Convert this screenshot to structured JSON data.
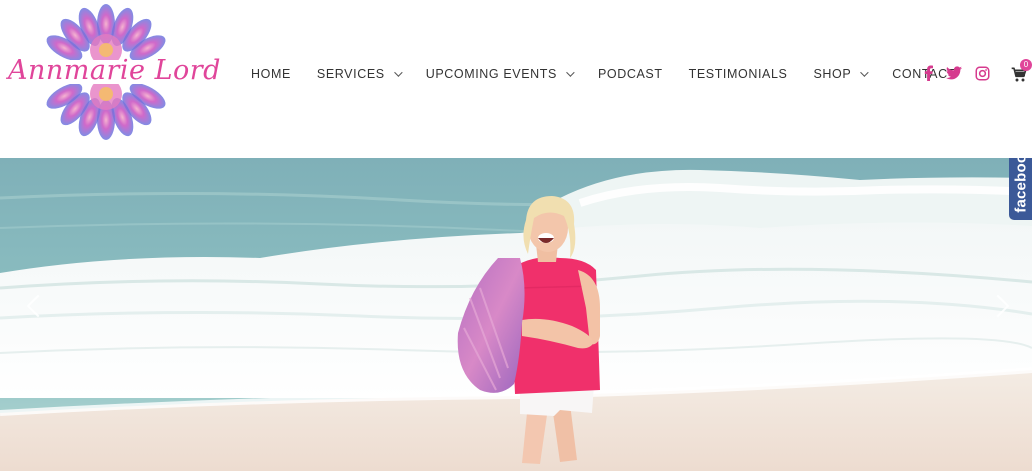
{
  "brand": {
    "logo_text": "Annmarie Lord",
    "colors": {
      "pink": "#e0459a",
      "purple": "#9b59d0",
      "blue": "#4a78d6"
    }
  },
  "nav": {
    "items": [
      {
        "label": "HOME",
        "has_dropdown": false
      },
      {
        "label": "SERVICES",
        "has_dropdown": true
      },
      {
        "label": "UPCOMING EVENTS",
        "has_dropdown": true
      },
      {
        "label": "PODCAST",
        "has_dropdown": false
      },
      {
        "label": "TESTIMONIALS",
        "has_dropdown": false
      },
      {
        "label": "SHOP",
        "has_dropdown": true
      },
      {
        "label": "CONTACT",
        "has_dropdown": false
      }
    ]
  },
  "social": {
    "icons": [
      "facebook-icon",
      "twitter-icon",
      "instagram-icon"
    ],
    "color": "#d63a8e"
  },
  "cart": {
    "icon": "cart-icon",
    "count": "0"
  },
  "hero": {
    "previous_icon": "chevron-left-icon",
    "next_icon": "chevron-right-icon"
  },
  "facebook_tab": {
    "label": "facebook",
    "color": "#3b5998"
  }
}
